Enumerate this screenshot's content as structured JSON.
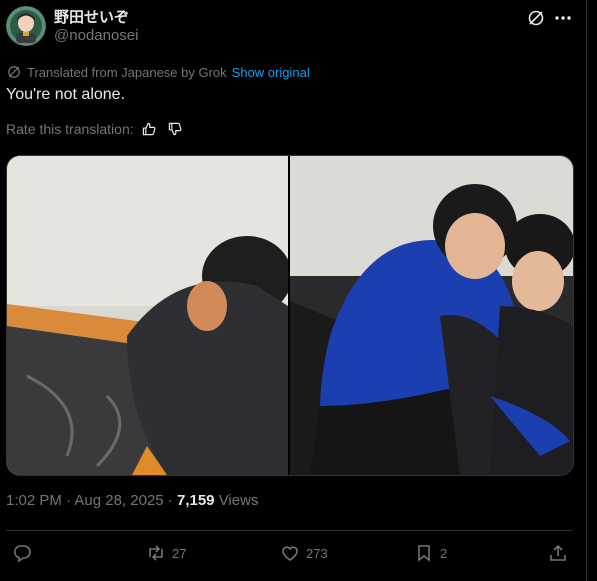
{
  "user": {
    "display_name": "野田せいぞ",
    "handle": "@nodanosei"
  },
  "translation": {
    "label": "Translated from Japanese by Grok",
    "show_original": "Show original",
    "rate_label": "Rate this translation:"
  },
  "tweet": {
    "text": "You're not alone.",
    "time": "1:02 PM",
    "date": "Aug 28, 2025",
    "views_count": "7,159",
    "views_label": "Views"
  },
  "actions": {
    "replies": "",
    "reposts": "27",
    "likes": "273",
    "bookmarks": "2"
  },
  "icons": {
    "grok": "grok-icon",
    "more": "more-icon",
    "reply": "reply-icon",
    "repost": "repost-icon",
    "like": "heart-icon",
    "bookmark": "bookmark-icon",
    "share": "share-icon"
  },
  "colors": {
    "background": "#000000",
    "text": "#e7e9ea",
    "muted": "#71767b",
    "link": "#1d9bf0",
    "border": "#2f3336"
  }
}
